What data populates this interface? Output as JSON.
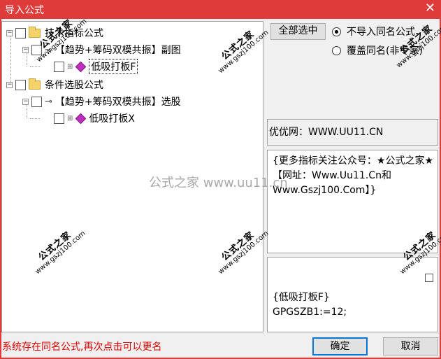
{
  "window": {
    "title": "导入公式",
    "close_glyph": "✕",
    "accent_color": "#e03b3b"
  },
  "tree": {
    "nodes": [
      {
        "label": "技术指标公式",
        "icon": "folder-icon"
      },
      {
        "label": "【趋势+筹码双模共振】副图",
        "icon": "key-icon"
      },
      {
        "label": "低吸打板F",
        "icon": "gem-icon"
      },
      {
        "label": "条件选股公式",
        "icon": "folder-icon"
      },
      {
        "label": "【趋势+筹码双模共振】选股",
        "icon": "key-icon"
      },
      {
        "label": "低吸打板X",
        "icon": "gem-icon"
      }
    ]
  },
  "options": {
    "select_all_label": "全部选中",
    "radio_no_import": "不导入同名公式",
    "radio_overwrite": "覆盖同名(非专家)",
    "selected": "no_import"
  },
  "info": {
    "site": "优优网：WWW.UU11.CN",
    "description": "{更多指标关注公众号：★公式之家★【网址：Www.Uu11.Cn和Www.Gszj100.Com】}",
    "formula_line1": "{低吸打板F}",
    "formula_line2": "GPGSZB1:=12;"
  },
  "footer": {
    "status": "系统存在同名公式,再次点击可以更名",
    "ok_label": "确定",
    "cancel_label": "取消",
    "status_color": "#e00000"
  },
  "watermark": {
    "center_text": "公式之家 www.uu11.cn",
    "brand": "公式之家",
    "url": "www.gszj100.com"
  }
}
